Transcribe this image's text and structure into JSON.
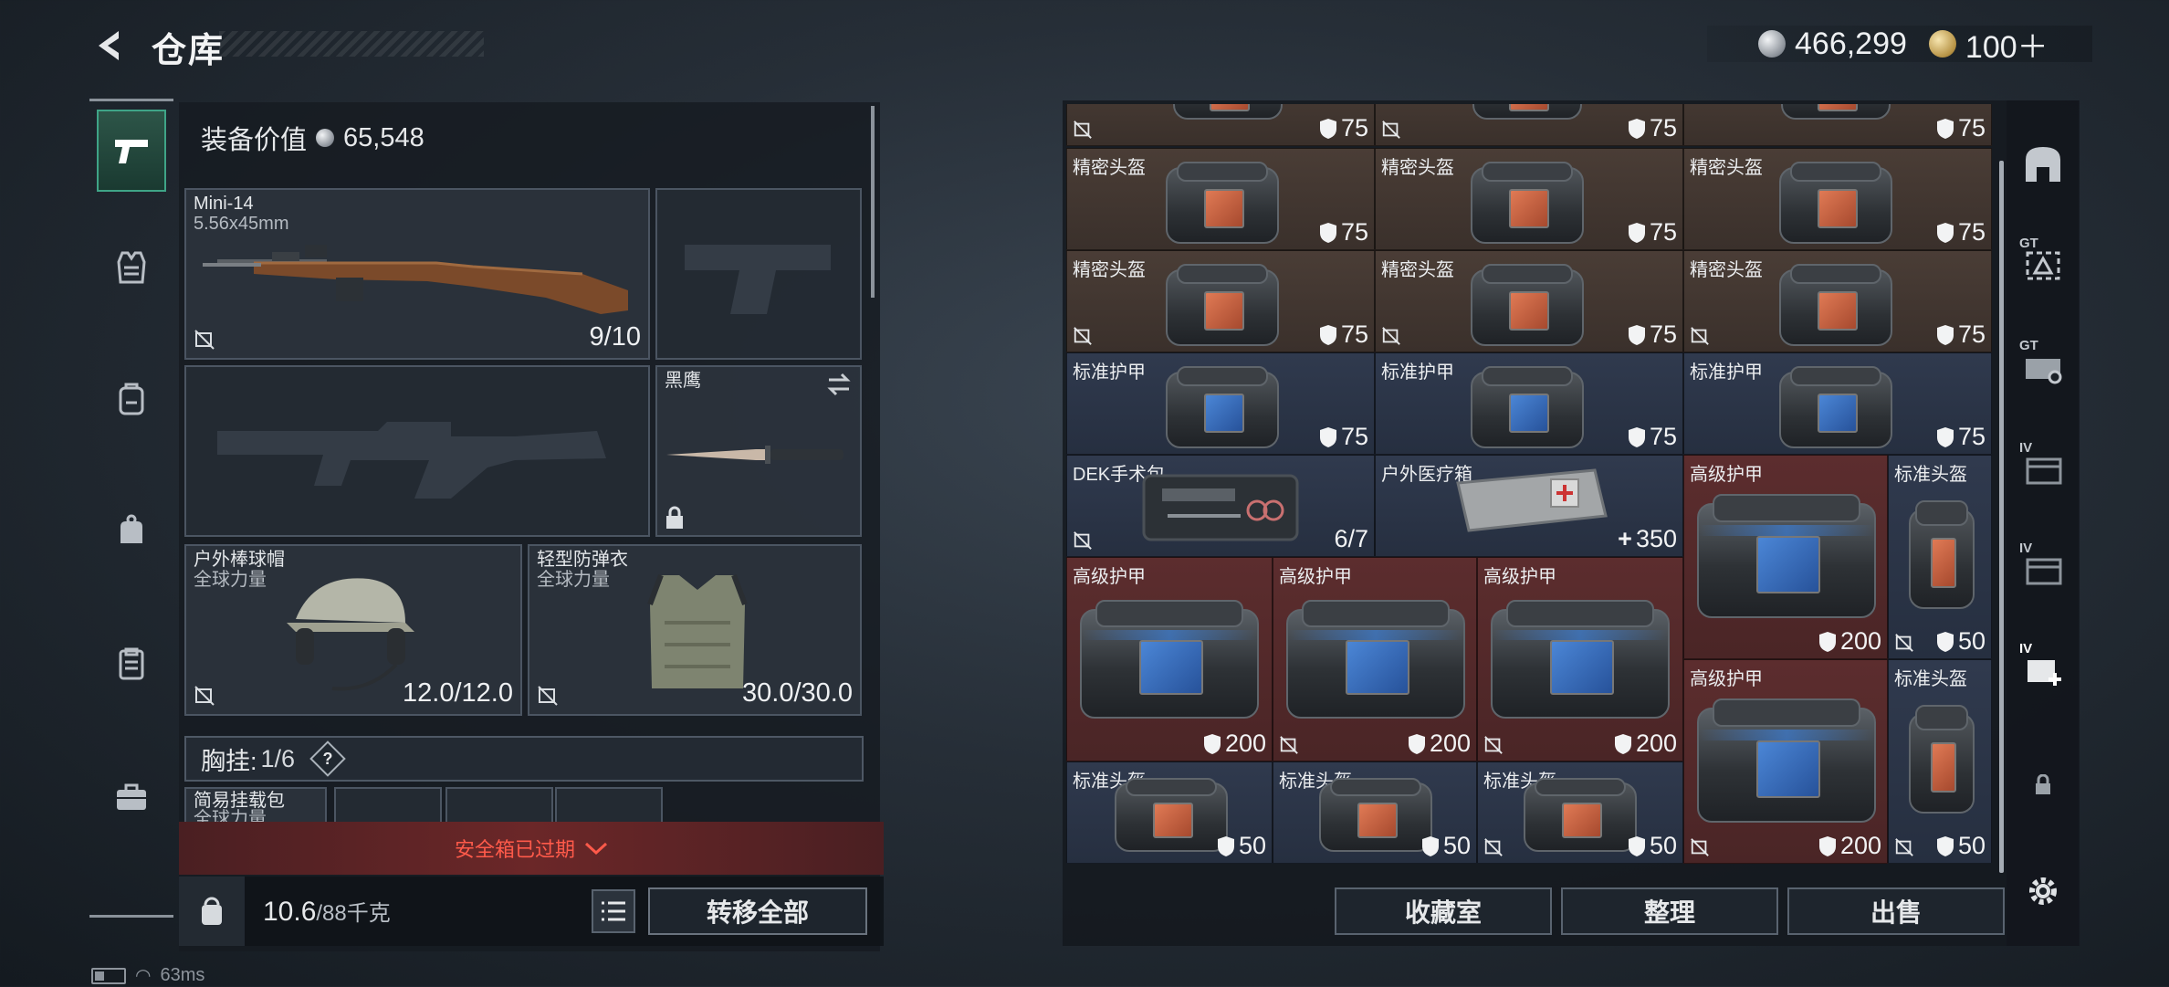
{
  "header": {
    "title": "仓库",
    "currency": [
      {
        "icon": "silver-coin-icon",
        "value": "466,299"
      },
      {
        "icon": "gold-coin-icon",
        "value": "100＋"
      }
    ]
  },
  "left_nav": {
    "items": [
      "pistol-icon",
      "vest-icon",
      "backpack-icon",
      "rig-icon",
      "clipboard-icon",
      "briefcase-icon"
    ],
    "active": "pistol-icon"
  },
  "equipment": {
    "value_label": "装备价值",
    "value": "65,548",
    "primary_weapon": {
      "name": "Mini-14",
      "caliber": "5.56x45mm",
      "durability": "9/10"
    },
    "melee": {
      "name": "黑鹰"
    },
    "helmet": {
      "name": "户外棒球帽",
      "faction": "全球力量",
      "durability": "12.0/12.0"
    },
    "armor": {
      "name": "轻型防弹衣",
      "faction": "全球力量",
      "durability": "30.0/30.0"
    },
    "chest_rig": {
      "label": "胸挂:",
      "count": "1/6",
      "help": "?"
    },
    "rig_item": {
      "name": "简易挂载包",
      "faction": "全球力量"
    },
    "safe_box_status": "安全箱已过期",
    "weight_current": "10.6",
    "weight_max": "/88千克",
    "transfer_all": "转移全部"
  },
  "storage": {
    "top_row_values": [
      "75",
      "75",
      "75"
    ],
    "items": [
      {
        "name": "精密头盔",
        "value": "75"
      },
      {
        "name": "精密头盔",
        "value": "75"
      },
      {
        "name": "精密头盔",
        "value": "75"
      },
      {
        "name": "精密头盔",
        "value": "75"
      },
      {
        "name": "精密头盔",
        "value": "75"
      },
      {
        "name": "精密头盔",
        "value": "75"
      },
      {
        "name": "标准护甲",
        "value": "75"
      },
      {
        "name": "标准护甲",
        "value": "75"
      },
      {
        "name": "标准护甲",
        "value": "75"
      },
      {
        "name": "DEK手术包",
        "value": "6/7"
      },
      {
        "name": "户外医疗箱",
        "value": "350"
      },
      {
        "name": "高级护甲",
        "value": "200"
      },
      {
        "name": "标准头盔",
        "value": "50"
      },
      {
        "name": "高级护甲",
        "value": "200"
      },
      {
        "name": "高级护甲",
        "value": "200"
      },
      {
        "name": "高级护甲",
        "value": "200"
      },
      {
        "name": "高级护甲",
        "value": "200"
      },
      {
        "name": "标准头盔",
        "value": "50"
      },
      {
        "name": "标准头盔",
        "value": "50"
      },
      {
        "name": "标准头盔",
        "value": "50"
      },
      {
        "name": "标准头盔",
        "value": "50"
      }
    ]
  },
  "actions": {
    "collection": "收藏室",
    "organize": "整理",
    "sell": "出售"
  },
  "right_nav": {
    "labels": [
      "GT",
      "GT",
      "IV",
      "IV",
      "IV"
    ]
  },
  "status": {
    "ping": "63ms"
  },
  "colors": {
    "accent": "#3fa487",
    "warning": "#ff5a4a",
    "cell_brown": "#4a3d36",
    "cell_blue": "#303a4e",
    "cell_red": "#5c2d2e"
  }
}
